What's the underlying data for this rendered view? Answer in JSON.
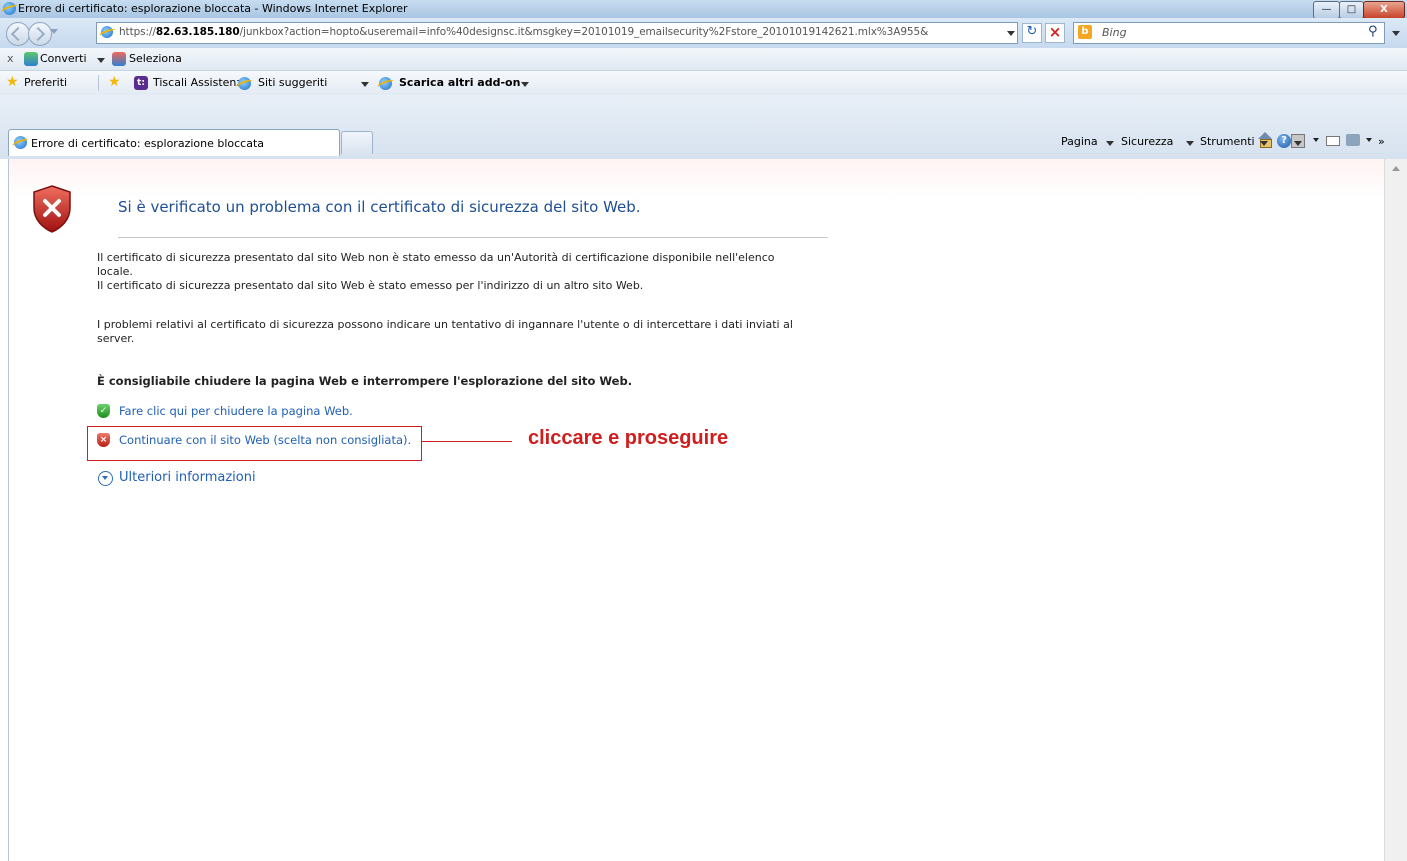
{
  "window": {
    "title": "Errore di certificato: esplorazione bloccata - Windows Internet Explorer",
    "controls": [
      "minimize-icon",
      "maximize-icon",
      "close-icon"
    ]
  },
  "navigation": {
    "url_prefix": "https://",
    "url_host": "82.63.185.180",
    "url_rest": "/junkbox?action=hopto&useremail=info%40designsc.it&msgkey=20101019_emailsecurity%2Fstore_20101019142621.mlx%3A955&",
    "search_placeholder": "Bing"
  },
  "pdf_toolbar": {
    "close": "x",
    "convert_label": "Converti",
    "select_label": "Seleziona"
  },
  "favorites_bar": {
    "favorites_label": "Preferiti",
    "items": [
      "Tiscali Assistenza",
      "Siti suggeriti",
      "Scarica altri add-on"
    ]
  },
  "tabs": {
    "active_title": "Errore di certificato: esplorazione bloccata"
  },
  "command_bar": {
    "page_label": "Pagina",
    "safety_label": "Sicurezza",
    "tools_label": "Strumenti",
    "overflow": "»"
  },
  "content": {
    "heading": "Si è verificato un problema con il certificato di sicurezza del sito Web.",
    "para1_line1": "Il certificato di sicurezza presentato dal sito Web non è stato emesso da un'Autorità di certificazione disponibile nell'elenco",
    "para1_line2": "locale.",
    "para1_line3": "Il certificato di sicurezza presentato dal sito Web è stato emesso per l'indirizzo di un altro sito Web.",
    "para2": "I problemi relativi al certificato di sicurezza possono indicare un tentativo di ingannare l'utente o di intercettare i dati inviati al server.",
    "recommendation": "È consigliabile chiudere la pagina Web e interrompere l'esplorazione del sito Web.",
    "close_link": "Fare clic qui per chiudere la pagina Web.",
    "continue_link": "Continuare con il sito Web (scelta non consigliata).",
    "more_info": "Ulteriori informazioni",
    "annotation": "cliccare e proseguire"
  },
  "colors": {
    "link": "#1f5fb5",
    "heading": "#1f4f93",
    "annotation": "#d01d1d"
  }
}
